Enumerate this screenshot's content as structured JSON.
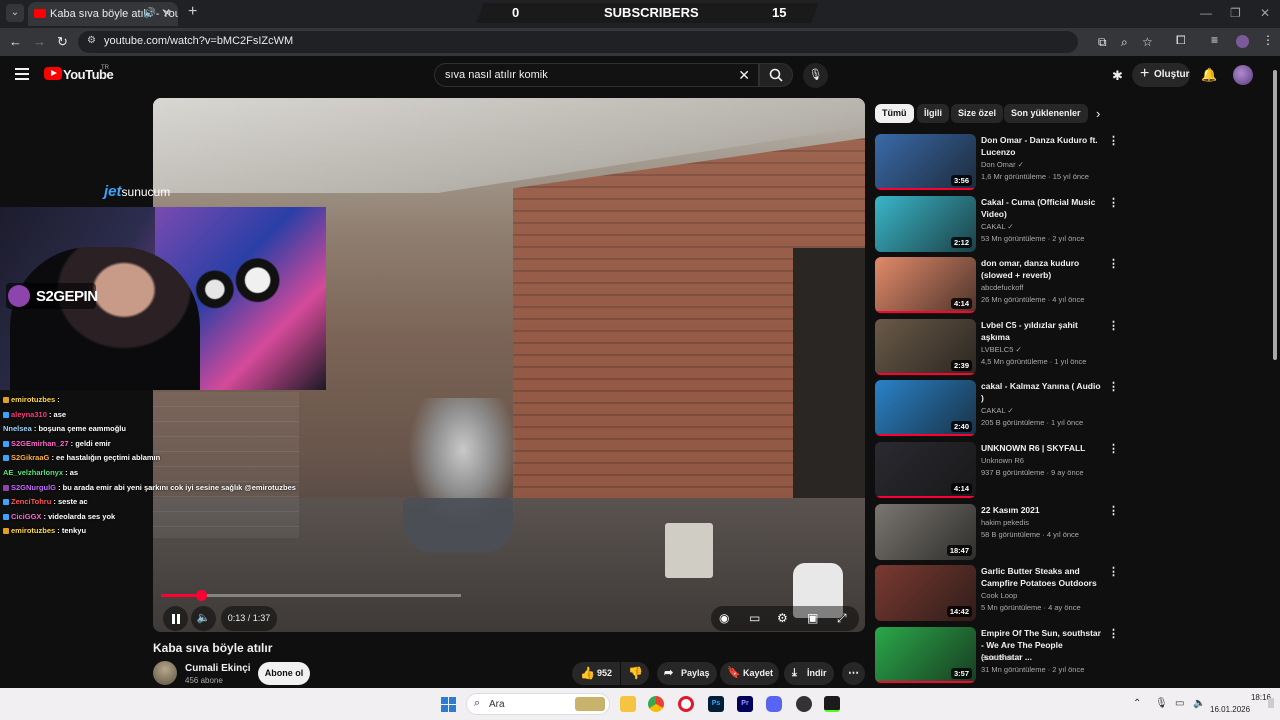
{
  "browser": {
    "tab_title": "Kaba sıva böyle atılır - YouTube",
    "url": "youtube.com/watch?v=bMC2FsIZcWM"
  },
  "overlay_bar": {
    "left_value": "0",
    "label": "SUBSCRIBERS",
    "right_value": "15"
  },
  "youtube": {
    "logo_text": "YouTube",
    "country": "TR",
    "search_query": "sıva nasıl atılır komik",
    "create_label": "Oluştur"
  },
  "stream": {
    "sponsor_prefix": "jet",
    "sponsor_suffix": "sunucum",
    "streamer": "S2GEPIN",
    "chat": [
      {
        "user": "emirotuzbes",
        "msg": " : ",
        "color": "#ffd84a",
        "badge": "#e0a020"
      },
      {
        "user": "aleyna310",
        "msg": " : ase",
        "color": "#ff3b7a",
        "badge": "#3aa5ff"
      },
      {
        "user": "Nnelsea",
        "msg": " : boşuna çeme eammoğlu",
        "color": "#9fd5ff",
        "badge": ""
      },
      {
        "user": "S2GEmirhan_27",
        "msg": " : geldi emir",
        "color": "#ff66cc",
        "badge": "#3aa5ff"
      },
      {
        "user": "S2GikraaG",
        "msg": " : ee hastalığın geçtimi ablamın",
        "color": "#ffae42",
        "badge": "#3aa5ff"
      },
      {
        "user": "AE_velzharlonyx",
        "msg": " : as",
        "color": "#58e07a",
        "badge": ""
      },
      {
        "user": "S2GNurgulG",
        "msg": " : bu arada emir abi yeni şarkını cok iyi sesine sağlık @emirotuzbes",
        "color": "#c56bff",
        "badge": "#8e44ad"
      },
      {
        "user": "ZenciTohru",
        "msg": " : seste ac",
        "color": "#ff5555",
        "badge": "#3aa5ff"
      },
      {
        "user": "CiciGGX",
        "msg": " : videolarda ses yok",
        "color": "#ff66cc",
        "badge": "#3aa5ff"
      },
      {
        "user": "emirotuzbes",
        "msg": " : tenkyu",
        "color": "#ffd84a",
        "badge": "#e0a020"
      }
    ]
  },
  "player": {
    "time": "0:13 / 1:37",
    "progress_fraction": 0.134
  },
  "video": {
    "title": "Kaba sıva böyle atılır",
    "channel": "Cumali Ekinçi",
    "subscribers": "456 abone",
    "subscribe_label": "Abone ol",
    "likes": "952",
    "share_label": "Paylaş",
    "save_label": "Kaydet",
    "download_label": "İndir"
  },
  "chips": [
    "Tümü",
    "İlgili",
    "Size özel",
    "Son yüklenenler"
  ],
  "recommendations": [
    {
      "title": "Don Omar - Danza Kuduro ft. Lucenzo",
      "channel": "Don Omar",
      "verified": true,
      "meta": "1,6 Mr görüntüleme · 15 yıl önce",
      "duration": "3:56",
      "thumb": "#3a6aa8",
      "watched": true
    },
    {
      "title": "Cakal - Cuma (Official Music Video)",
      "channel": "CAKAL",
      "verified": true,
      "meta": "53 Mn görüntüleme · 2 yıl önce",
      "duration": "2:12",
      "thumb": "#39b6c8",
      "watched": false
    },
    {
      "title": "don omar, danza kuduro (slowed + reverb)",
      "channel": "abcdefuckoff",
      "verified": false,
      "meta": "26 Mn görüntüleme · 4 yıl önce",
      "duration": "4:14",
      "thumb": "#e28a6a",
      "watched": true
    },
    {
      "title": "Lvbel C5 - yıldızlar şahit aşkıma",
      "channel": "LVBELC5",
      "verified": true,
      "meta": "4,5 Mn görüntüleme · 1 yıl önce",
      "duration": "2:39",
      "thumb": "#6a5a48",
      "watched": true
    },
    {
      "title": "cakal - Kalmaz Yanına ( Audio )",
      "channel": "CAKAL",
      "verified": true,
      "meta": "205 B görüntüleme · 1 yıl önce",
      "duration": "2:40",
      "thumb": "#2a82c8",
      "watched": true
    },
    {
      "title": "UNKNOWN R6 | SKYFALL",
      "channel": "Unknown R6",
      "verified": false,
      "meta": "937 B görüntüleme · 9 ay önce",
      "duration": "4:14",
      "thumb": "#2a2a30",
      "watched": true
    },
    {
      "title": "22 Kasım 2021",
      "channel": "hakim pekedis",
      "verified": false,
      "meta": "58 B görüntüleme · 4 yıl önce",
      "duration": "18:47",
      "thumb": "#7a7670",
      "watched": false
    },
    {
      "title": "Garlic Butter Steaks and Campfire Potatoes Outdoors",
      "channel": "Cook Loop",
      "verified": false,
      "meta": "5 Mn görüntüleme · 4 ay önce",
      "duration": "14:42",
      "thumb": "#7a3a30",
      "watched": false
    },
    {
      "title": "Empire Of The Sun, southstar - We Are The People (southstar ...",
      "channel": "Southstar",
      "verified": true,
      "meta": "31 Mn görüntüleme · 2 yıl önce",
      "duration": "3:57",
      "thumb": "#2aa84a",
      "watched": true
    }
  ],
  "taskbar": {
    "search_placeholder": "Ara",
    "time": "18:16",
    "date": "16.01.2026"
  }
}
